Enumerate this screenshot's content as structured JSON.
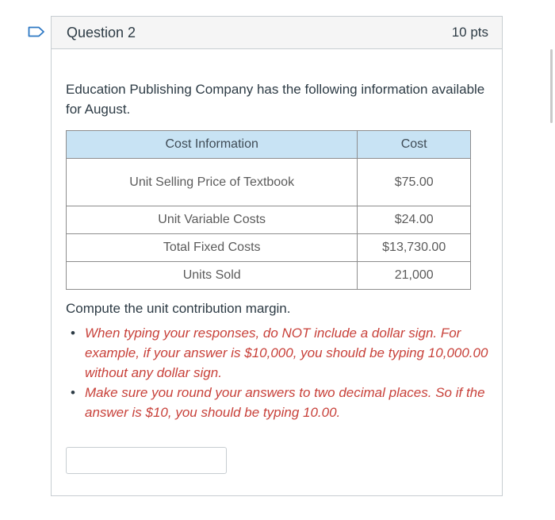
{
  "question": {
    "title": "Question 2",
    "points": "10 pts",
    "intro": "Education Publishing Company has the following information available for August.",
    "table": {
      "headers": [
        "Cost Information",
        "Cost"
      ],
      "rows": [
        [
          "Unit Selling Price of Textbook",
          "$75.00"
        ],
        [
          "Unit Variable Costs",
          "$24.00"
        ],
        [
          "Total Fixed Costs",
          "$13,730.00"
        ],
        [
          "Units Sold",
          "21,000"
        ]
      ]
    },
    "prompt": "Compute the unit contribution margin.",
    "notes": [
      "When typing your responses, do NOT include a dollar sign. For example, if your answer is $10,000, you should be typing 10,000.00 without any dollar sign.",
      "Make sure you round your answers to two decimal places. So if the answer is $10, you should be typing 10.00."
    ],
    "answer": {
      "value": "",
      "placeholder": ""
    }
  },
  "colors": {
    "flag": "#2d78c4",
    "header_bg": "#f5f5f5",
    "table_header_bg": "#c8e3f4",
    "note_text": "#c8413a"
  },
  "icons": {
    "flag": "bookmark-flag-icon"
  }
}
